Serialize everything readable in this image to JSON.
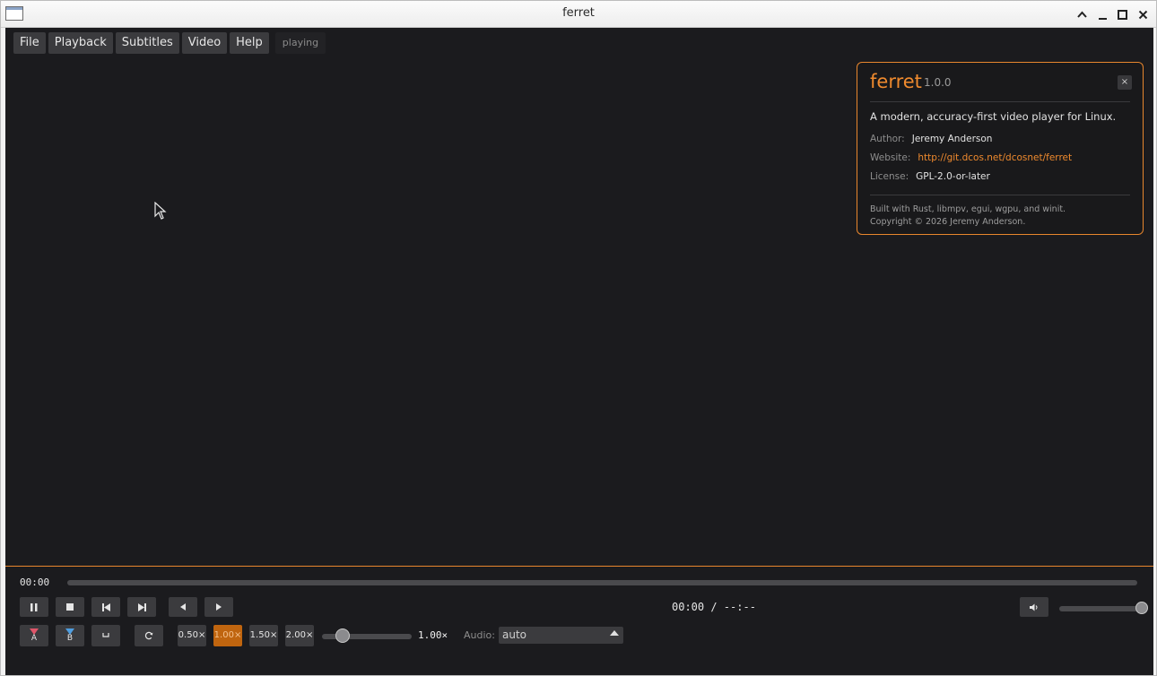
{
  "window": {
    "title": "ferret"
  },
  "menu": {
    "items": [
      "File",
      "Playback",
      "Subtitles",
      "Video",
      "Help"
    ],
    "status": "playing"
  },
  "about": {
    "app_name": "ferret",
    "version": "1.0.0",
    "close_label": "×",
    "description": "A modern, accuracy-first video player for Linux.",
    "author_label": "Author:",
    "author": "Jeremy Anderson",
    "website_label": "Website:",
    "website": "http://git.dcos.net/dcosnet/ferret",
    "license_label": "License:",
    "license": "GPL-2.0-or-later",
    "built_with": "Built with Rust, libmpv, egui, wgpu, and winit.",
    "copyright": "Copyright © 2026 Jeremy Anderson."
  },
  "controls": {
    "elapsed": "00:00",
    "time_display": "00:00 / --:--",
    "seek_progress": 0,
    "volume_level": 1.0,
    "ab_a_label": "A",
    "ab_b_label": "B",
    "speed_presets": [
      "0.50×",
      "1.00×",
      "1.50×",
      "2.00×"
    ],
    "active_speed": "1.00×",
    "speed_readout": "1.00×",
    "audio_label": "Audio:",
    "audio_value": "auto"
  },
  "colors": {
    "accent": "#e8862d",
    "background": "#1b1b1e",
    "button": "#3b3b3e"
  }
}
